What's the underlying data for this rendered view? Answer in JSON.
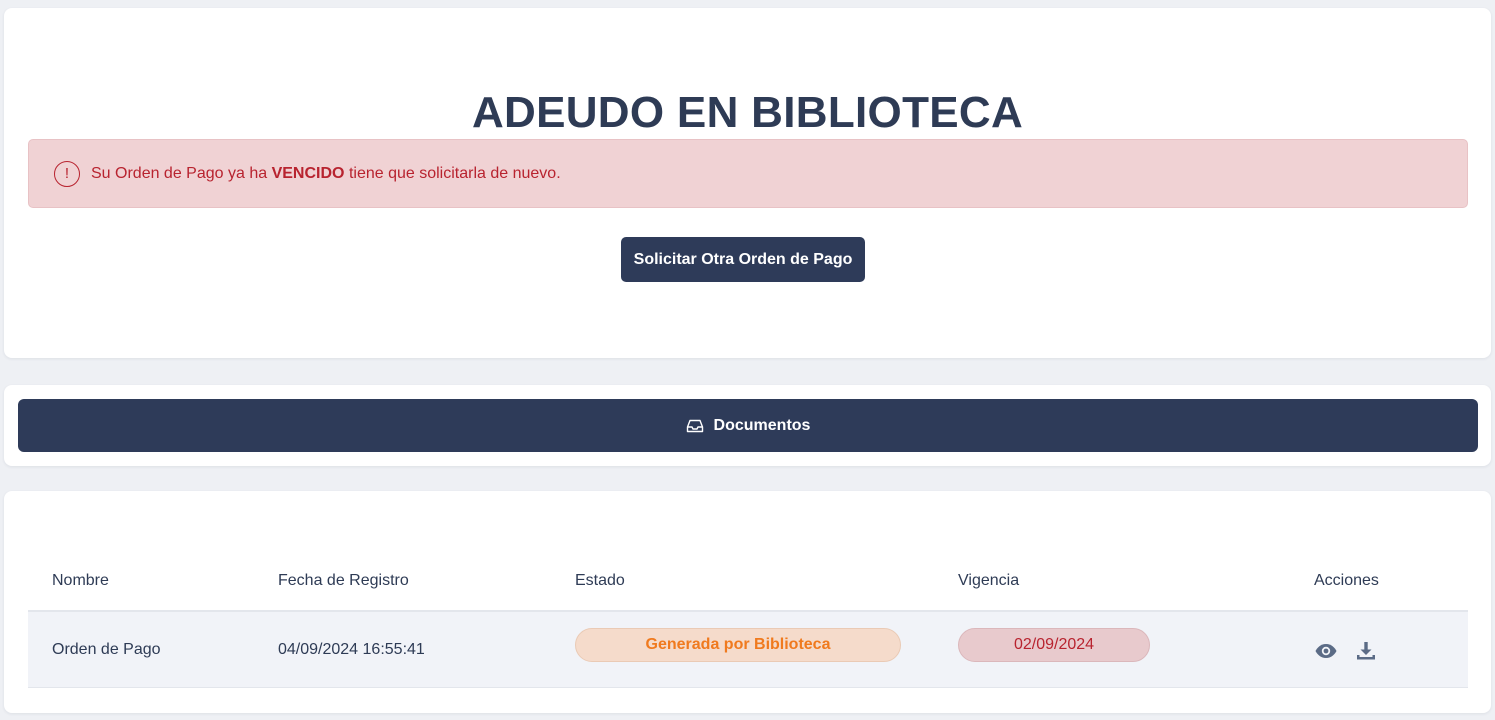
{
  "page": {
    "title": "ADEUDO EN BIBLIOTECA"
  },
  "alert": {
    "icon": "exclamation-circle-icon",
    "text_before": "Su Orden de Pago ya ha",
    "text_bold": "VENCIDO",
    "text_after": "tiene que solicitarla de nuevo.",
    "color": "#b8232f"
  },
  "request_button": {
    "label": "Solicitar Otra Orden de Pago"
  },
  "documents": {
    "icon": "inbox-icon",
    "label": "Documentos"
  },
  "table": {
    "headers": [
      "Nombre",
      "Fecha de Registro",
      "Estado",
      "Vigencia",
      "Acciones"
    ],
    "rows": [
      {
        "name": "Orden de Pago",
        "date": "04/09/2024 16:55:41",
        "status": "Generada por Biblioteca",
        "validity": "02/09/2024",
        "actions": [
          "eye-icon",
          "download-icon"
        ]
      }
    ]
  },
  "colors": {
    "primary": "#2e3b59",
    "status_orange": "#f07a1e",
    "danger": "#b8232f",
    "background": "#eef0f4"
  }
}
